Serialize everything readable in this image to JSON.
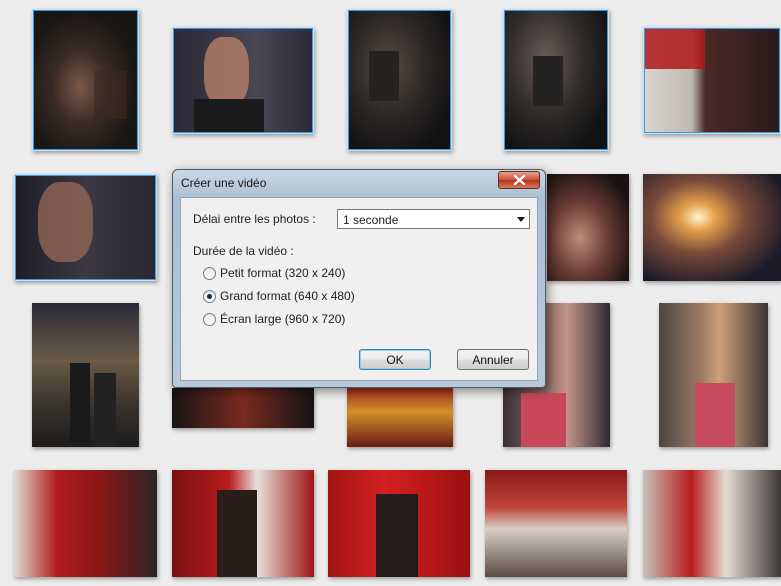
{
  "dialog": {
    "title": "Créer une vidéo",
    "close_icon": "close-x-icon",
    "delay_label": "Délai entre les photos :",
    "delay_value": "1 seconde",
    "duration_label": "Durée de la vidéo :",
    "options": [
      {
        "label": "Petit format (320 x 240)",
        "selected": false
      },
      {
        "label": "Grand format (640 x 480)",
        "selected": true
      },
      {
        "label": "Écran large (960 x 720)",
        "selected": false
      }
    ],
    "ok_label": "OK",
    "cancel_label": "Annuler"
  },
  "colors": {
    "selection_border": "#3b9de0",
    "gallery_background": "#ececec"
  }
}
